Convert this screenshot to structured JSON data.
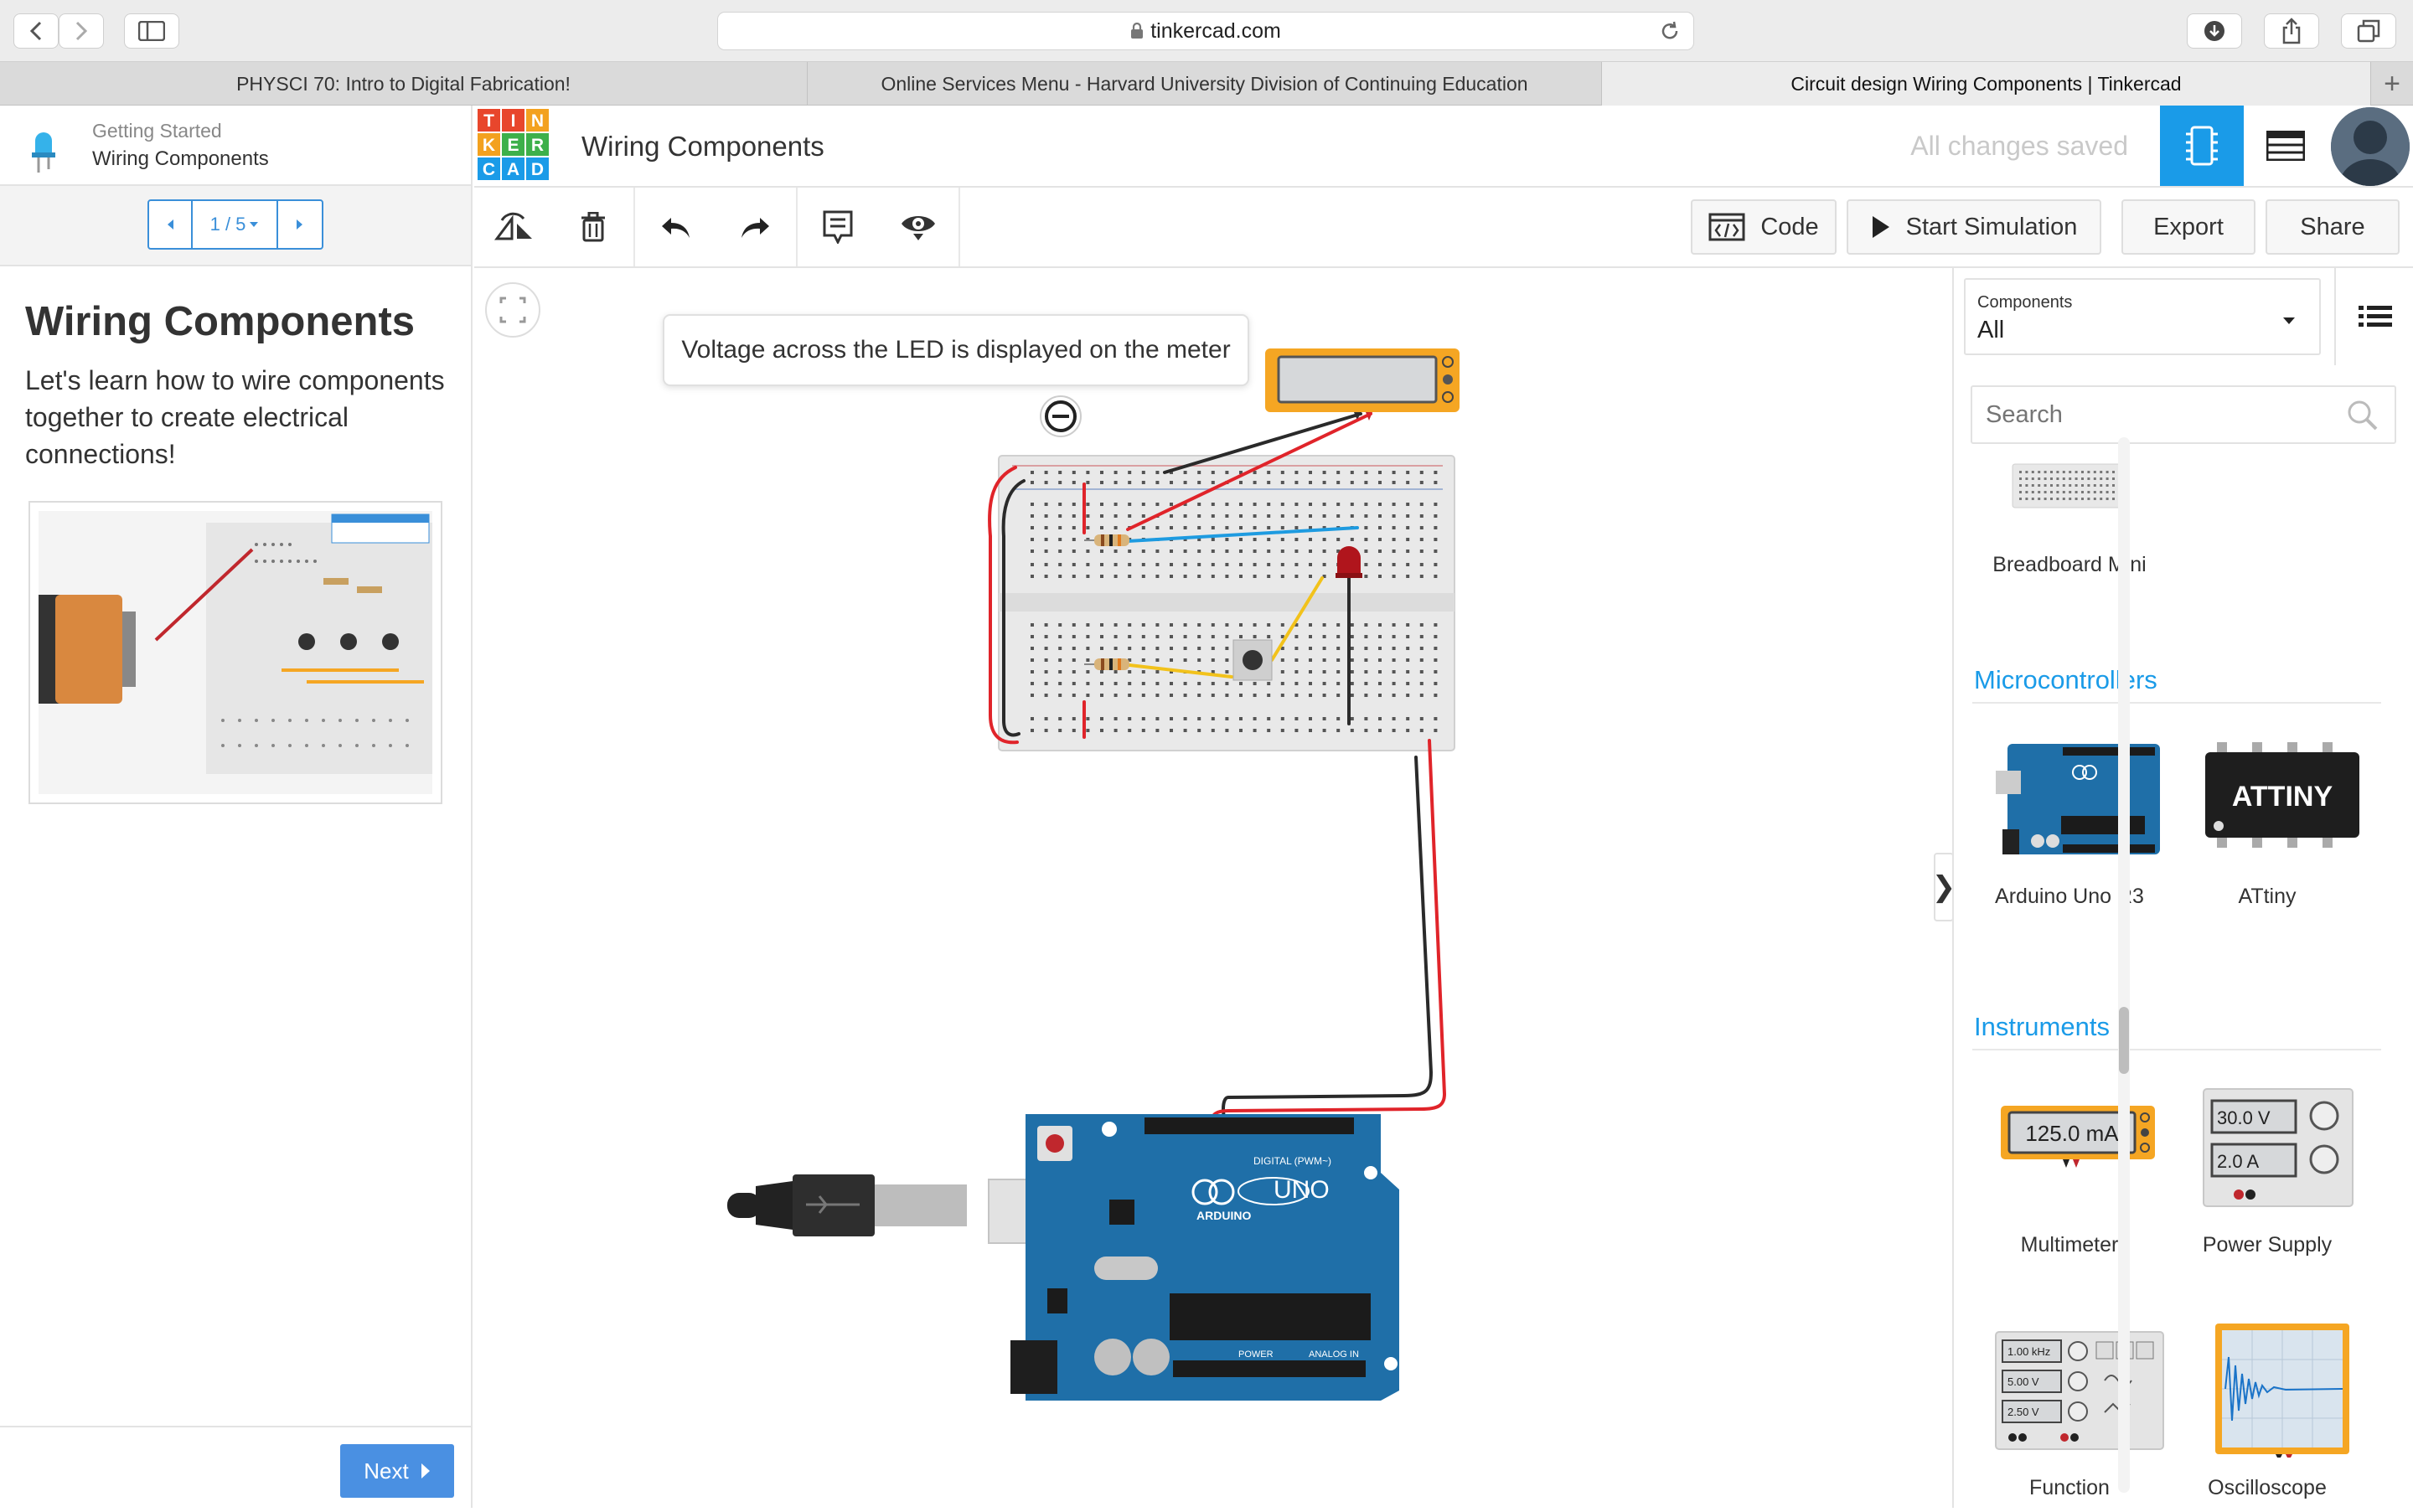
{
  "browser": {
    "url": "tinkercad.com",
    "tabs": [
      {
        "label": "PHYSCI 70: Intro to Digital Fabrication!",
        "active": false
      },
      {
        "label": "Online Services Menu - Harvard University Division of Continuing Education",
        "active": false
      },
      {
        "label": "Circuit design Wiring Components | Tinkercad",
        "active": true
      }
    ],
    "new_tab_label": "+"
  },
  "lesson": {
    "breadcrumb_top": "Getting Started",
    "breadcrumb_bottom": "Wiring Components",
    "pager": "1 / 5",
    "title": "Wiring Components",
    "description": "Let's learn how to wire components together to create electrical connections!",
    "next_label": "Next"
  },
  "header": {
    "logo_letters": [
      "T",
      "I",
      "N",
      "K",
      "E",
      "R",
      "C",
      "A",
      "D"
    ],
    "logo_colors": [
      "#e8462c",
      "#e8462c",
      "#f3a11f",
      "#f3a11f",
      "#3db04a",
      "#3db04a",
      "#1a9be8",
      "#1a9be8",
      "#1a9be8"
    ],
    "design_title": "Wiring Components",
    "save_status": "All changes saved"
  },
  "toolbar": {
    "code_label": "Code",
    "simulate_label": "Start Simulation",
    "export_label": "Export",
    "share_label": "Share"
  },
  "canvas": {
    "tooltip": "Voltage across the LED is displayed on the meter",
    "arduino_logo": "UNO",
    "arduino_brand": "ARDUINO",
    "arduino_digital_label": "DIGITAL (PWM~)",
    "arduino_power_label": "POWER",
    "arduino_analog_label": "ANALOG IN"
  },
  "components_panel": {
    "filter_caption": "Components",
    "filter_value": "All",
    "search_placeholder": "Search",
    "sections": [
      {
        "title": "Microcontrollers",
        "items": [
          "Arduino Uno R3",
          "ATtiny"
        ]
      },
      {
        "title": "Instruments",
        "items": [
          "Multimeter",
          "Power Supply",
          "Function",
          "Oscilloscope"
        ]
      }
    ],
    "breadboard_mini_label": "Breadboard Mini",
    "attiny_chip_text": "ATTINY",
    "multimeter_readout": "125.0 mA",
    "power_supply_voltage": "30.0 V",
    "power_supply_current": "2.0 A",
    "function_gen_freq": "1.00 kHz",
    "function_gen_amp": "5.00 V",
    "function_gen_offset": "2.50 V"
  },
  "colors": {
    "accent": "#1a9be8",
    "next_button": "#4a90e2",
    "wire_red": "#e0242a",
    "wire_black": "#2a2a2a",
    "wire_blue": "#1e9be0",
    "wire_yellow": "#f2c21b",
    "arduino_blue": "#1f6fa8",
    "meter_orange": "#f5a623"
  }
}
